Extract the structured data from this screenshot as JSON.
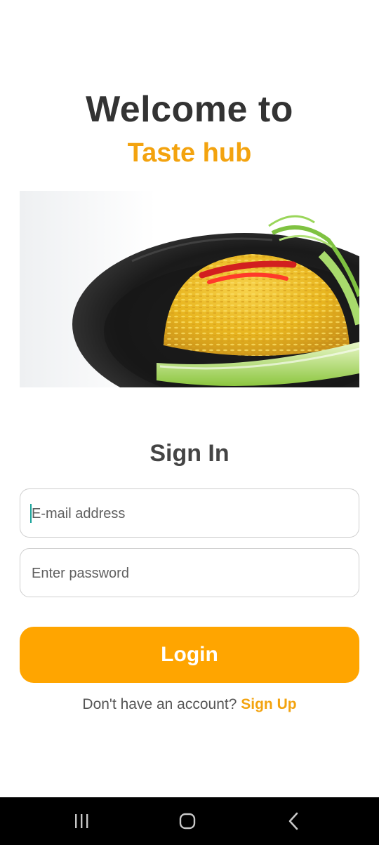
{
  "header": {
    "welcome": "Welcome to",
    "app_name": "Taste hub"
  },
  "hero": {
    "icon": "fried-rice-dish-image"
  },
  "form": {
    "title": "Sign In",
    "email_placeholder": "E-mail address",
    "password_placeholder": "Enter password",
    "login_label": "Login"
  },
  "footer": {
    "prompt": "Don't have an account? ",
    "signup_label": "Sign Up"
  },
  "system_nav": {
    "recents_icon": "recents-icon",
    "home_icon": "home-icon",
    "back_icon": "back-icon"
  },
  "colors": {
    "accent": "#ffa500",
    "brand_text": "#f3a30f",
    "title": "#333333",
    "field_border": "#cfcfcf",
    "cursor": "#1aa39a"
  }
}
